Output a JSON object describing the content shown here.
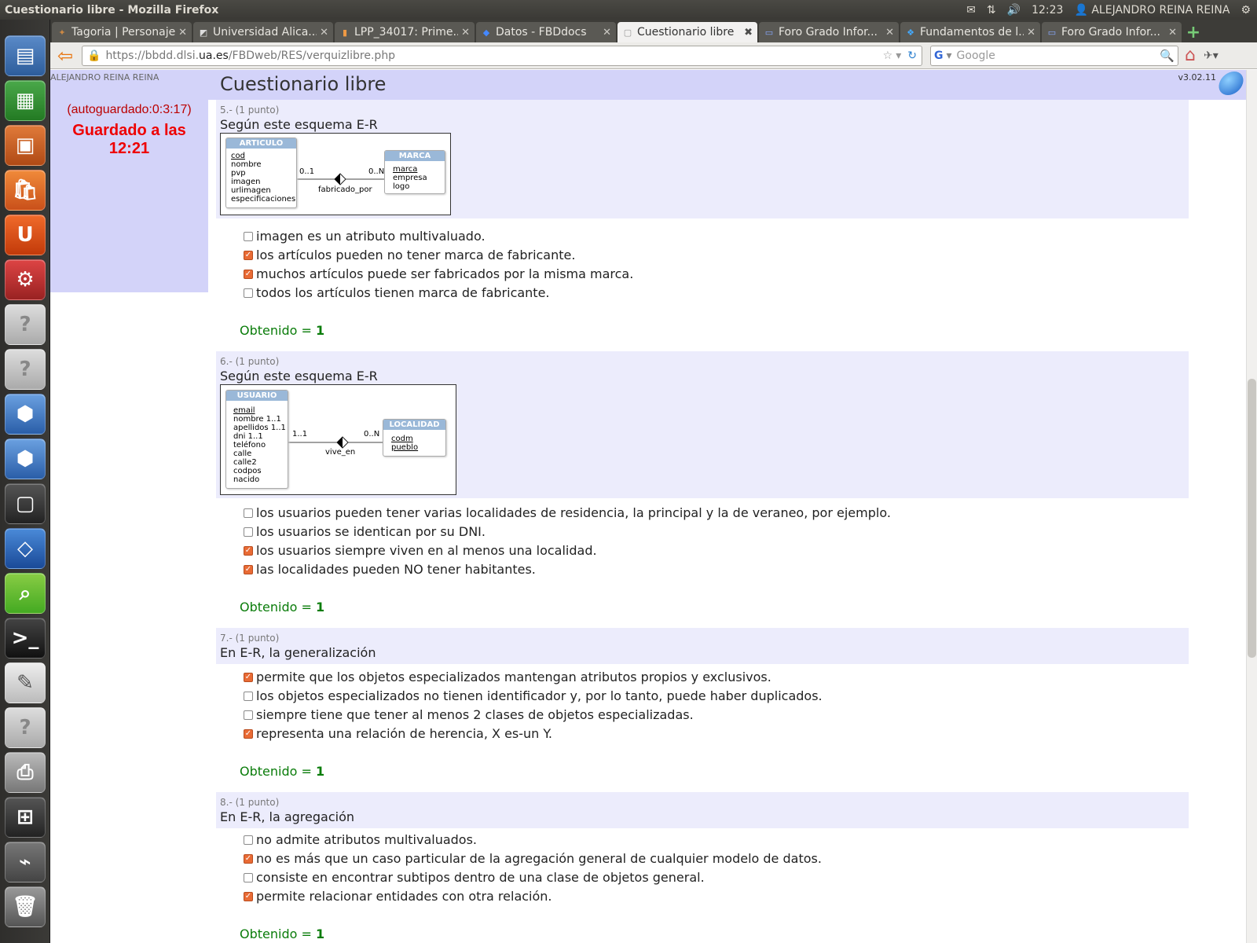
{
  "system": {
    "window_title": "Cuestionario libre - Mozilla Firefox",
    "time": "12:23",
    "user": "ALEJANDRO REINA REINA"
  },
  "tabs": [
    {
      "label": "Tagoria | Personaje",
      "icon": "tagoria-favicon-icon"
    },
    {
      "label": "Universidad Alica...",
      "icon": "ua-favicon-icon"
    },
    {
      "label": "LPP_34017: Prime...",
      "icon": "lpp-favicon-icon"
    },
    {
      "label": "Datos - FBDdocs",
      "icon": "docs-favicon-icon"
    },
    {
      "label": "Cuestionario libre",
      "icon": "blank-page-icon",
      "active": true
    },
    {
      "label": "Foro Grado Infor...",
      "icon": "forum-favicon-icon"
    },
    {
      "label": "Fundamentos de l...",
      "icon": "dropbox-favicon-icon"
    },
    {
      "label": "Foro Grado Infor...",
      "icon": "forum-favicon-icon"
    }
  ],
  "navbar": {
    "url_prefix": "https://bbdd.dlsi.",
    "url_domain": "ua.es",
    "url_path": "/FBDweb/RES/verquizlibre.php",
    "search_placeholder": "Google"
  },
  "page": {
    "user": "ALEJANDRO REINA REINA",
    "title": "Cuestionario libre",
    "version": "v3.02.11",
    "autosave": "(autoguardado:0:3:17)",
    "saved": "Guardado a las 12:21"
  },
  "questions": [
    {
      "number": "5.- (1 punto)",
      "text": "Según este esquema E-R",
      "diagram": {
        "entity1": {
          "name": "ARTICULO",
          "key": "cod",
          "attrs": [
            "nombre",
            "pvp",
            "imagen",
            "urlimagen",
            "especificaciones"
          ]
        },
        "entity2": {
          "name": "MARCA",
          "key": "marca",
          "attrs": [
            "empresa",
            "logo"
          ]
        },
        "card1": "0..1",
        "card2": "0..N",
        "relation": "fabricado_por"
      },
      "options": [
        {
          "text": "imagen es un atributo multivaluado.",
          "checked": false
        },
        {
          "text": "los artículos pueden no tener marca de fabricante.",
          "checked": true
        },
        {
          "text": "muchos artículos puede ser fabricados por la misma marca.",
          "checked": true
        },
        {
          "text": "todos los artículos tienen marca de fabricante.",
          "checked": false
        }
      ],
      "obtained_label": "Obtenido = ",
      "obtained": "1"
    },
    {
      "number": "6.- (1 punto)",
      "text": "Según este esquema E-R",
      "diagram": {
        "entity1": {
          "name": "USUARIO",
          "key": "email",
          "attrs": [
            "nombre 1..1",
            "apellidos 1..1",
            "dni 1..1",
            "teléfono",
            "calle",
            "calle2",
            "codpos",
            "nacido"
          ]
        },
        "entity2": {
          "name": "LOCALIDAD",
          "key": "codm",
          "attrs": [
            "pueblo"
          ]
        },
        "card1": "1..1",
        "card2": "0..N",
        "relation": "vive_en"
      },
      "options": [
        {
          "text": "los usuarios pueden tener varias localidades de residencia, la principal y la de veraneo, por ejemplo.",
          "checked": false
        },
        {
          "text": "los usuarios se identican por su DNI.",
          "checked": false
        },
        {
          "text": "los usuarios siempre viven en al menos una localidad.",
          "checked": true
        },
        {
          "text": "las localidades pueden NO tener habitantes.",
          "checked": true
        }
      ],
      "obtained_label": "Obtenido = ",
      "obtained": "1"
    },
    {
      "number": "7.- (1 punto)",
      "text": "En E-R, la generalización",
      "options": [
        {
          "text": "permite que los objetos especializados mantengan atributos propios y exclusivos.",
          "checked": true
        },
        {
          "text": "los objetos especializados no tienen identificador y, por lo tanto, puede haber duplicados.",
          "checked": false
        },
        {
          "text": "siempre tiene que tener al menos 2 clases de objetos especializadas.",
          "checked": false
        },
        {
          "text": "representa una relación de herencia, X es-un Y.",
          "checked": true
        }
      ],
      "obtained_label": "Obtenido = ",
      "obtained": "1"
    },
    {
      "number": "8.- (1 punto)",
      "text": "En E-R, la agregación",
      "options": [
        {
          "text": "no admite atributos multivaluados.",
          "checked": false
        },
        {
          "text": "no es más que un caso particular de la agregación general de cualquier modelo de datos.",
          "checked": true
        },
        {
          "text": "consiste en encontrar subtipos dentro de una clase de objetos general.",
          "checked": false
        },
        {
          "text": "permite relacionar entidades con otra relación.",
          "checked": true
        }
      ],
      "obtained_label": "Obtenido = ",
      "obtained": "1"
    }
  ],
  "colors": {
    "header_bg": "#d3d3f9",
    "question_bg": "#ececfc",
    "checked": "#e96b35",
    "obtained": "#0a7c0a",
    "saved": "#ee0000"
  }
}
